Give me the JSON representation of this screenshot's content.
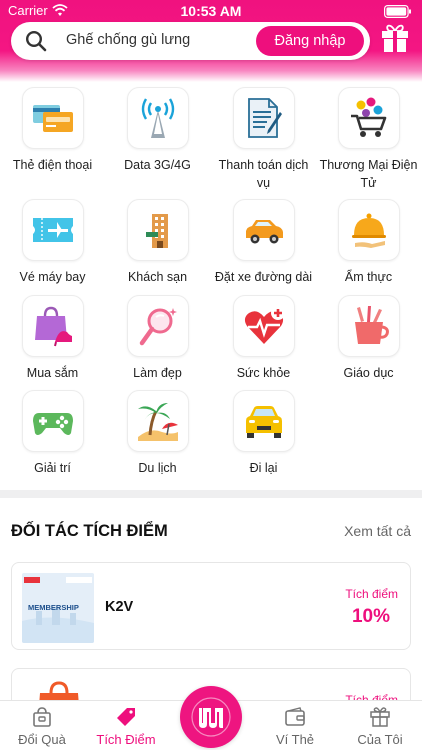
{
  "status": {
    "carrier": "Carrier",
    "time": "10:53 AM"
  },
  "search": {
    "placeholder": "Ghế chống gù lưng"
  },
  "header": {
    "login_label": "Đăng nhập"
  },
  "categories": [
    {
      "label": "Thẻ điện thoại",
      "icon": "phone-card-icon"
    },
    {
      "label": "Data 3G/4G",
      "icon": "signal-tower-icon"
    },
    {
      "label": "Thanh toán dịch vụ",
      "icon": "bill-document-icon"
    },
    {
      "label": "Thương Mại Điện Tử",
      "icon": "shopping-cart-icon"
    },
    {
      "label": "Vé máy bay",
      "icon": "flight-ticket-icon"
    },
    {
      "label": "Khách sạn",
      "icon": "hotel-icon"
    },
    {
      "label": "Đặt xe đường dài",
      "icon": "car-icon"
    },
    {
      "label": "Ẩm thực",
      "icon": "food-cloche-icon"
    },
    {
      "label": "Mua sắm",
      "icon": "shopping-bag-icon"
    },
    {
      "label": "Làm đẹp",
      "icon": "beauty-mirror-icon"
    },
    {
      "label": "Sức khỏe",
      "icon": "health-heart-icon"
    },
    {
      "label": "Giáo dục",
      "icon": "education-cup-icon"
    },
    {
      "label": "Giải trí",
      "icon": "gamepad-icon"
    },
    {
      "label": "Du lịch",
      "icon": "beach-icon"
    },
    {
      "label": "Đi lại",
      "icon": "taxi-icon"
    }
  ],
  "partners": {
    "title": "ĐỐI TÁC TÍCH ĐIỂM",
    "see_all": "Xem tất cả",
    "items": [
      {
        "name": "K2V",
        "points_label": "Tích điểm",
        "points_value": "10%",
        "logo_text": "MEMBERSHIP"
      },
      {
        "name": "",
        "points_label": "Tích điểm",
        "points_value": ""
      }
    ]
  },
  "tabs": [
    {
      "label": "Đổi Quà",
      "icon": "gift-bag-icon",
      "active": false
    },
    {
      "label": "Tích Điểm",
      "icon": "tag-icon",
      "active": true
    },
    {
      "label": "",
      "icon": "app-logo-icon",
      "active": false
    },
    {
      "label": "Ví Thẻ",
      "icon": "wallet-icon",
      "active": false
    },
    {
      "label": "Của Tôi",
      "icon": "gift-box-icon",
      "active": false
    }
  ],
  "colors": {
    "brand": "#ee0f7d",
    "accent_text": "#ee0f7d",
    "divider": "#efeff0"
  }
}
